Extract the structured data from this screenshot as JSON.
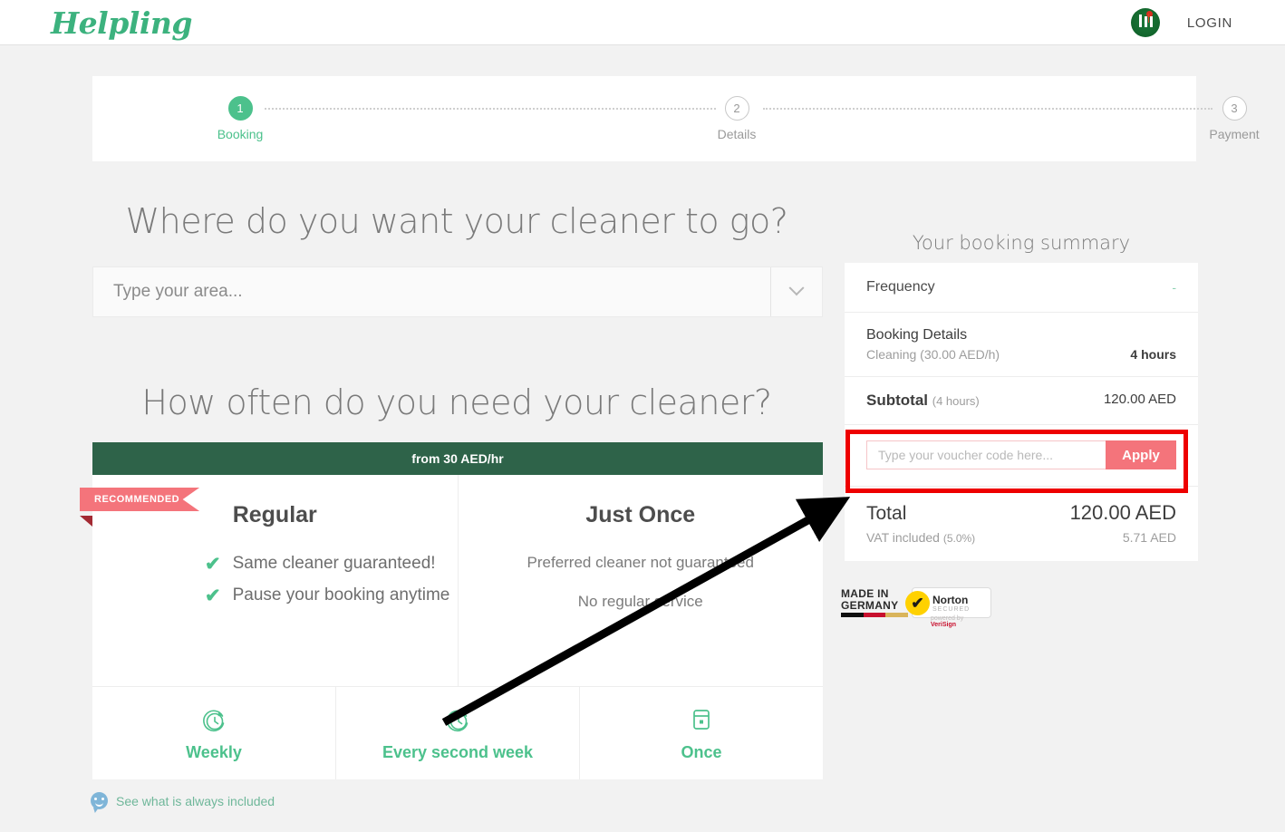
{
  "header": {
    "logo_text": "Helpling",
    "badge_icon": "green-circular-award-badge-icon",
    "login_label": "LOGIN"
  },
  "stepper": {
    "steps": [
      {
        "number": "1",
        "label": "Booking",
        "state": "active"
      },
      {
        "number": "2",
        "label": "Details",
        "state": "inactive"
      },
      {
        "number": "3",
        "label": "Payment",
        "state": "inactive"
      }
    ]
  },
  "main": {
    "where_heading": "Where do you want your cleaner to go?",
    "area_placeholder": "Type your area...",
    "area_value": "",
    "area_caret_icon": "chevron-down-icon",
    "often_heading": "How often do you need your cleaner?",
    "price_banner": "from 30 AED/hr",
    "recommended_ribbon": "RECOMMENDED",
    "plans": [
      {
        "title": "Regular",
        "type": "checklist",
        "features": [
          "Same cleaner guaranteed!",
          "Pause your booking anytime"
        ],
        "check_icon": "check-icon"
      },
      {
        "title": "Just Once",
        "type": "plain",
        "features": [
          "Preferred cleaner not guaranteed",
          "No regular service"
        ]
      }
    ],
    "frequency_options": [
      {
        "label": "Weekly",
        "icon": "clock-refresh-icon"
      },
      {
        "label": "Every second week",
        "icon": "clock-refresh-icon"
      },
      {
        "label": "Once",
        "icon": "calendar-single-day-icon"
      }
    ],
    "included_link": "See what is always included",
    "included_icon": "smiley-speech-bubble-icon"
  },
  "summary": {
    "title": "Your booking summary",
    "frequency_label": "Frequency",
    "frequency_value": "-",
    "booking_details_title": "Booking Details",
    "booking_details_sub": "Cleaning (30.00 AED/h)",
    "booking_details_value": "4 hours",
    "subtotal_label": "Subtotal",
    "subtotal_paren": "(4 hours)",
    "subtotal_value": "120.00 AED",
    "voucher_placeholder": "Type your voucher code here...",
    "voucher_value": "",
    "apply_label": "Apply",
    "total_label": "Total",
    "total_value": "120.00 AED",
    "vat_label": "VAT included",
    "vat_paren": "(5.0%)",
    "vat_value": "5.71 AED"
  },
  "trust": {
    "made_line1": "MADE IN",
    "made_line2": "GERMANY",
    "norton_line1": "Norton",
    "norton_line2": "SECURED",
    "norton_sub_prefix": "powered by ",
    "norton_sub_brand": "VeriSign",
    "norton_check_icon": "check-icon"
  },
  "annotations": {
    "highlight_color": "#ee0000",
    "arrow_color": "#000000",
    "arrow_from": "every-second-week-option",
    "arrow_to": "voucher-code-field"
  },
  "colors": {
    "brand_green": "#4cc18c",
    "banner_green": "#2e6349",
    "accent_coral": "#f4747b",
    "page_bg": "#f2f2f2"
  }
}
